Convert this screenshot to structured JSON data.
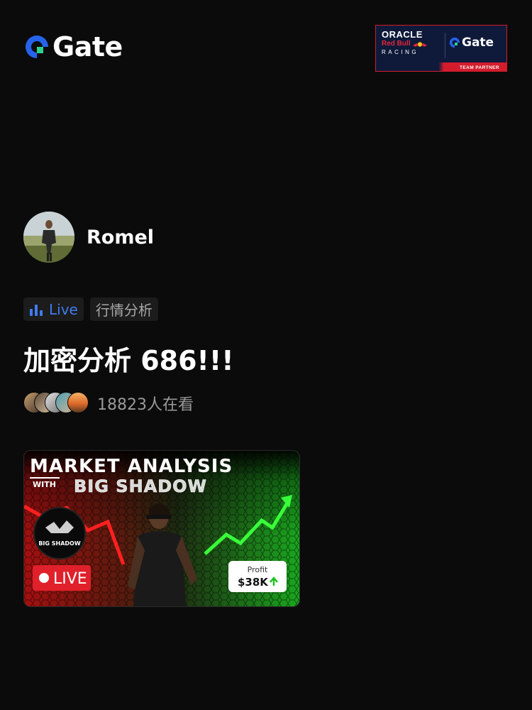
{
  "brand": {
    "logo_text": "Gate",
    "logo_icon": "gate-logo-icon"
  },
  "partner_badge": {
    "oracle": "ORACLE",
    "red_bull": "Red Bull",
    "racing": "RACING",
    "gate": "Gate",
    "strip_text": "TEAM PARTNER",
    "colors": {
      "navy": "#0f1a3a",
      "red": "#d41c2c"
    }
  },
  "author": {
    "name": "Romel"
  },
  "tags": {
    "live_label": "Live",
    "live_icon": "bar-chart-icon",
    "category": "行情分析"
  },
  "title": "加密分析 686!!!",
  "viewers": {
    "count_text": "18823人在看"
  },
  "thumbnail": {
    "headline": "MARKET ANALYSIS",
    "with": "WITH",
    "subheadline": "BIG SHADOW",
    "logo_text": "BIG SHADOW",
    "live_label": "LIVE",
    "profit_label": "Profit",
    "profit_value": "$38K"
  },
  "colors": {
    "background": "#0b0b0b",
    "accent_blue": "#3f7cf0",
    "brand_green": "#2bd38a",
    "live_red": "#e0202a",
    "chart_green": "#2fe03a"
  }
}
